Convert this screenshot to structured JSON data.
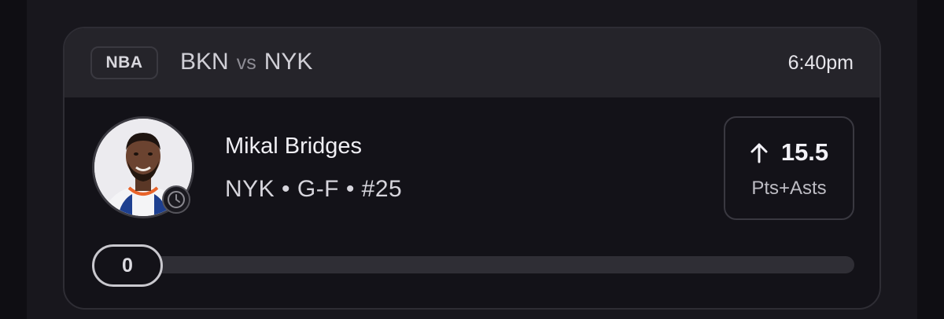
{
  "header": {
    "league": "NBA",
    "away_team": "BKN",
    "vs": "vs",
    "home_team": "NYK",
    "time": "6:40pm"
  },
  "player": {
    "name": "Mikal Bridges",
    "meta": "NYK • G-F • #25",
    "avatar_icon": "player-headshot",
    "status_icon": "clock-icon"
  },
  "line": {
    "direction_icon": "arrow-up-icon",
    "value": "15.5",
    "stat": "Pts+Asts"
  },
  "progress": {
    "current": "0",
    "fraction": 0
  },
  "colors": {
    "background": "#0f0e13",
    "panel": "#18171d",
    "card": "#131218",
    "card_header": "#25242a",
    "text_primary": "#f0eff4",
    "text_muted": "#8e8d95"
  }
}
